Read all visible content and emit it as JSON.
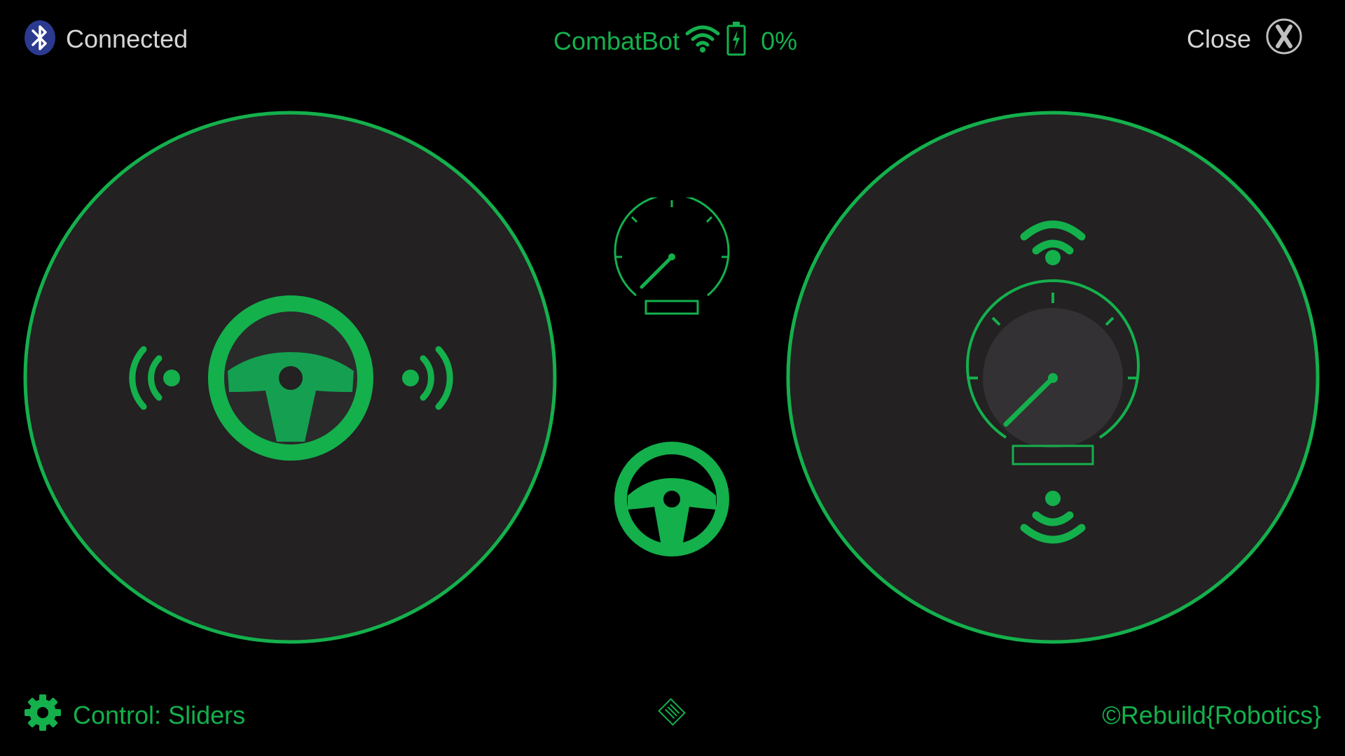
{
  "status": {
    "bluetooth_icon": "bluetooth-icon",
    "connection_label": "Connected"
  },
  "robot": {
    "name": "CombatBot",
    "signal_icon": "wifi-icon",
    "battery_icon": "battery-charging-icon",
    "battery_label": "0%"
  },
  "close": {
    "label": "Close",
    "icon": "close-x-icon"
  },
  "controls": {
    "mode_icon": "gear-icon",
    "mode_label": "Control: Sliders",
    "center_icon": "tag-icon",
    "copyright": "©Rebuild{Robotics}"
  },
  "left_pad": {
    "center_icon": "steering-wheel-icon",
    "left_icon": "signal-left-icon",
    "right_icon": "signal-right-icon"
  },
  "right_pad": {
    "center_icon": "speedometer-icon",
    "top_icon": "signal-up-icon",
    "bottom_icon": "signal-down-icon"
  },
  "mini": {
    "speed_icon": "speedometer-icon",
    "wheel_icon": "steering-wheel-icon"
  },
  "colors": {
    "accent": "#14b04c",
    "pad_fill": "#232122",
    "background": "#000000",
    "text_gray": "#d6d6d6",
    "bluetooth": "#2b3a8f"
  }
}
